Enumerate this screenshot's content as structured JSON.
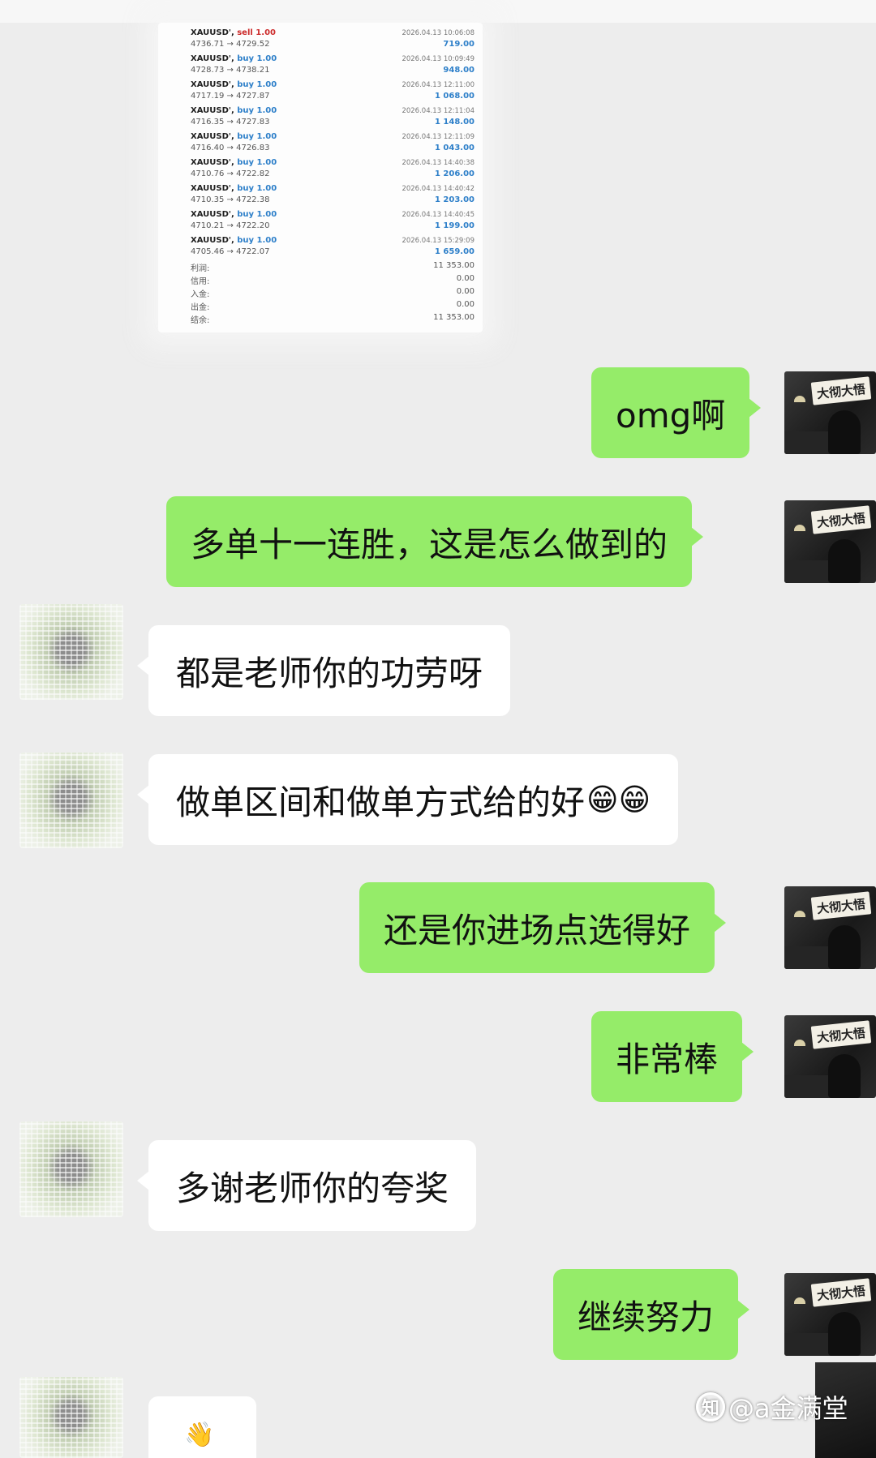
{
  "trade_card": {
    "trades": [
      {
        "symbol": "XAUUSD',",
        "side": "sell 1.00",
        "side_type": "sell",
        "prices": "4736.71 → 4729.52",
        "time": "2026.04.13 10:06:08",
        "profit": "719.00"
      },
      {
        "symbol": "XAUUSD',",
        "side": "buy 1.00",
        "side_type": "buy",
        "prices": "4728.73 → 4738.21",
        "time": "2026.04.13 10:09:49",
        "profit": "948.00"
      },
      {
        "symbol": "XAUUSD',",
        "side": "buy 1.00",
        "side_type": "buy",
        "prices": "4717.19 → 4727.87",
        "time": "2026.04.13 12:11:00",
        "profit": "1 068.00"
      },
      {
        "symbol": "XAUUSD',",
        "side": "buy 1.00",
        "side_type": "buy",
        "prices": "4716.35 → 4727.83",
        "time": "2026.04.13 12:11:04",
        "profit": "1 148.00"
      },
      {
        "symbol": "XAUUSD',",
        "side": "buy 1.00",
        "side_type": "buy",
        "prices": "4716.40 → 4726.83",
        "time": "2026.04.13 12:11:09",
        "profit": "1 043.00"
      },
      {
        "symbol": "XAUUSD',",
        "side": "buy 1.00",
        "side_type": "buy",
        "prices": "4710.76 → 4722.82",
        "time": "2026.04.13 14:40:38",
        "profit": "1 206.00"
      },
      {
        "symbol": "XAUUSD',",
        "side": "buy 1.00",
        "side_type": "buy",
        "prices": "4710.35 → 4722.38",
        "time": "2026.04.13 14:40:42",
        "profit": "1 203.00"
      },
      {
        "symbol": "XAUUSD',",
        "side": "buy 1.00",
        "side_type": "buy",
        "prices": "4710.21 → 4722.20",
        "time": "2026.04.13 14:40:45",
        "profit": "1 199.00"
      },
      {
        "symbol": "XAUUSD',",
        "side": "buy 1.00",
        "side_type": "buy",
        "prices": "4705.46 → 4722.07",
        "time": "2026.04.13 15:29:09",
        "profit": "1 659.00"
      }
    ],
    "summary": [
      {
        "label": "利润:",
        "value": "11 353.00"
      },
      {
        "label": "信用:",
        "value": "0.00"
      },
      {
        "label": "入金:",
        "value": "0.00"
      },
      {
        "label": "出金:",
        "value": "0.00"
      },
      {
        "label": "结余:",
        "value": "11 353.00"
      }
    ]
  },
  "messages": [
    {
      "from": "me",
      "text": "omg啊"
    },
    {
      "from": "me",
      "text": "多单十一连胜，这是怎么做到的"
    },
    {
      "from": "other",
      "text": "都是老师你的功劳呀"
    },
    {
      "from": "other",
      "text": "做单区间和做单方式给的好",
      "emoji": "😁😁"
    },
    {
      "from": "me",
      "text": "还是你进场点选得好"
    },
    {
      "from": "me",
      "text": "非常棒"
    },
    {
      "from": "other",
      "text": "多谢老师你的夸奖"
    },
    {
      "from": "me",
      "text": "继续努力"
    }
  ],
  "avatar_right": {
    "sign_text": "大彻大悟"
  },
  "partial_message": {
    "emoji": "👋"
  },
  "watermark": {
    "icon": "知",
    "text": "@a金满堂"
  }
}
